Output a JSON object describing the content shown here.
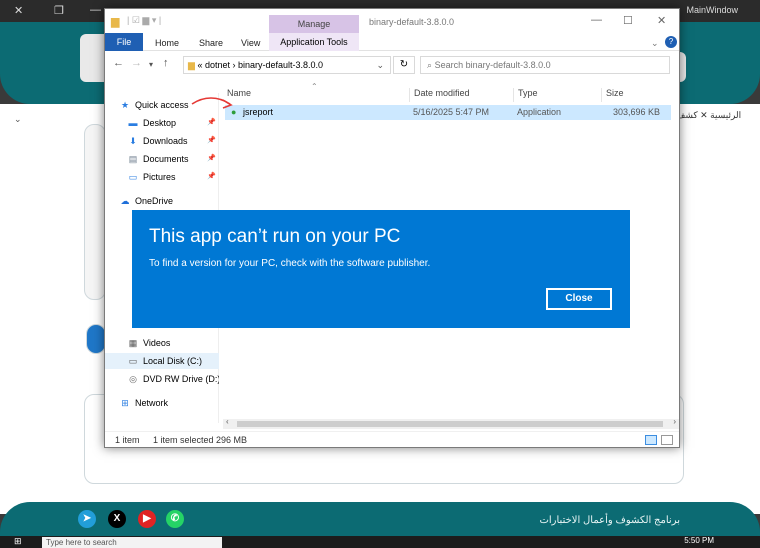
{
  "main_window": {
    "title": "MainWindow",
    "tabs_text": "الرئيسية  ✕  كشف",
    "footer_text": "برنامج الكشوف وأعمال الاختبارات"
  },
  "taskbar": {
    "search_placeholder": "Type here to search",
    "clock": "5:50 PM"
  },
  "explorer": {
    "manage_label": "Manage",
    "window_title": "binary-default-3.8.0.0",
    "ribbon": {
      "file": "File",
      "home": "Home",
      "share": "Share",
      "view": "View",
      "app_tools": "Application Tools"
    },
    "address_path": "« dotnet › binary-default-3.8.0.0",
    "search_placeholder": "Search binary-default-3.8.0.0",
    "columns": {
      "name": "Name",
      "date": "Date modified",
      "type": "Type",
      "size": "Size"
    },
    "sidebar": [
      {
        "label": "Quick access",
        "icon": "star-icon"
      },
      {
        "label": "Desktop",
        "icon": "desktop-icon"
      },
      {
        "label": "Downloads",
        "icon": "download-icon"
      },
      {
        "label": "Documents",
        "icon": "document-icon"
      },
      {
        "label": "Pictures",
        "icon": "picture-icon"
      },
      {
        "label": "OneDrive",
        "icon": "cloud-icon"
      },
      {
        "label": "Videos",
        "icon": "video-icon"
      },
      {
        "label": "Local Disk (C:)",
        "icon": "disk-icon"
      },
      {
        "label": "DVD RW Drive (D:) I",
        "icon": "dvd-icon"
      },
      {
        "label": "Network",
        "icon": "network-icon"
      }
    ],
    "file": {
      "name": "jsreport",
      "date": "5/16/2025 5:47 PM",
      "type": "Application",
      "size": "303,696 KB"
    },
    "status": {
      "count": "1 item",
      "selected": "1 item selected  296 MB"
    }
  },
  "dialog": {
    "title": "This app can’t run on your PC",
    "message": "To find a version for your PC, check with the software publisher.",
    "close_label": "Close"
  },
  "colors": {
    "teal": "#0c6b73",
    "dialog_blue": "#0078d4",
    "selection": "#cce8ff",
    "file_tab": "#1f5fb3"
  }
}
